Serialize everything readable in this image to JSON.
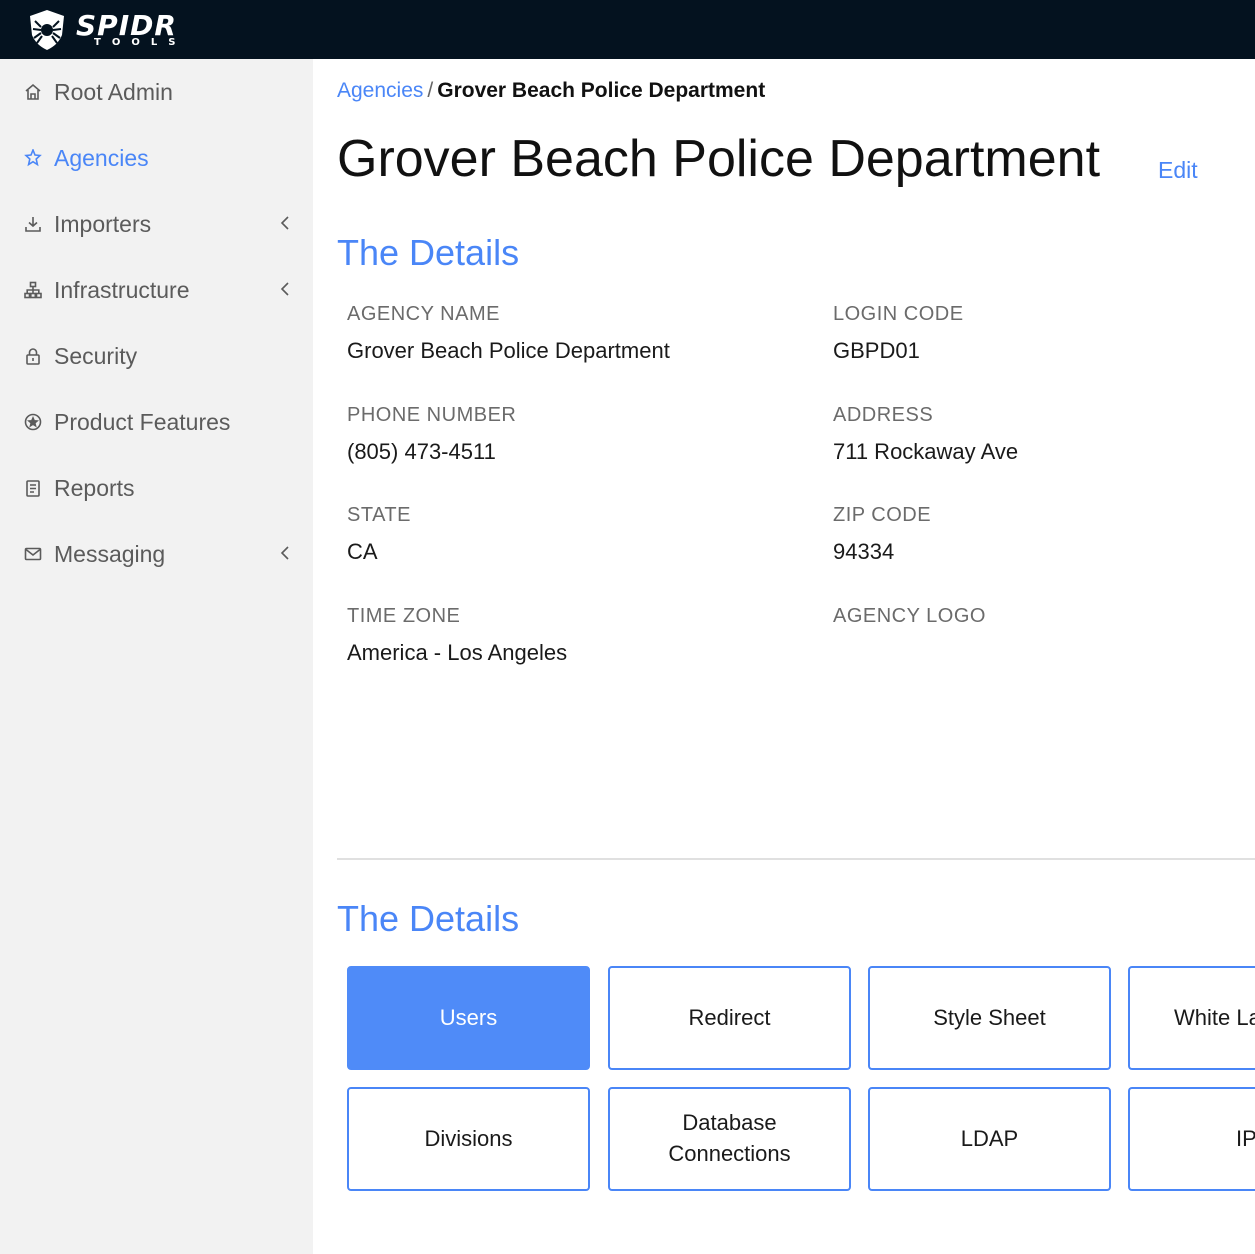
{
  "brand": {
    "name": "SPIDR",
    "sub": "TOOLS"
  },
  "sidebar": {
    "items": [
      {
        "label": "Root Admin",
        "icon": "home-icon"
      },
      {
        "label": "Agencies",
        "icon": "star-icon",
        "active": true
      },
      {
        "label": "Importers",
        "icon": "download-icon",
        "expandable": true
      },
      {
        "label": "Infrastructure",
        "icon": "sitemap-icon",
        "expandable": true
      },
      {
        "label": "Security",
        "icon": "lock-icon"
      },
      {
        "label": "Product Features",
        "icon": "badge-icon"
      },
      {
        "label": "Reports",
        "icon": "clipboard-icon"
      },
      {
        "label": "Messaging",
        "icon": "envelope-icon",
        "expandable": true
      }
    ]
  },
  "breadcrumb": {
    "parent": "Agencies",
    "separator": "/",
    "current": "Grover Beach Police Department"
  },
  "page": {
    "title": "Grover Beach Police Department",
    "edit_label": "Edit"
  },
  "details": {
    "title": "The Details",
    "fields": [
      {
        "label": "AGENCY NAME",
        "value": "Grover Beach Police Department"
      },
      {
        "label": "LOGIN CODE",
        "value": "GBPD01"
      },
      {
        "label": "PHONE NUMBER",
        "value": "(805) 473-4511"
      },
      {
        "label": "ADDRESS",
        "value": "711 Rockaway Ave"
      },
      {
        "label": "STATE",
        "value": "CA"
      },
      {
        "label": "ZIP CODE",
        "value": "94334"
      },
      {
        "label": "TIME ZONE",
        "value": "America - Los Angeles"
      },
      {
        "label": "AGENCY LOGO",
        "value": ""
      }
    ]
  },
  "actions": {
    "title": "The Details",
    "tiles": [
      {
        "label": "Users",
        "active": true
      },
      {
        "label": "Redirect"
      },
      {
        "label": "Style Sheet"
      },
      {
        "label": "White La"
      },
      {
        "label": "Divisions"
      },
      {
        "label": "Database\nConnections"
      },
      {
        "label": "LDAP"
      },
      {
        "label": "IP"
      }
    ]
  },
  "colors": {
    "accent": "#4a86f7",
    "topbar": "#04121f",
    "sidebar": "#f2f2f2"
  }
}
